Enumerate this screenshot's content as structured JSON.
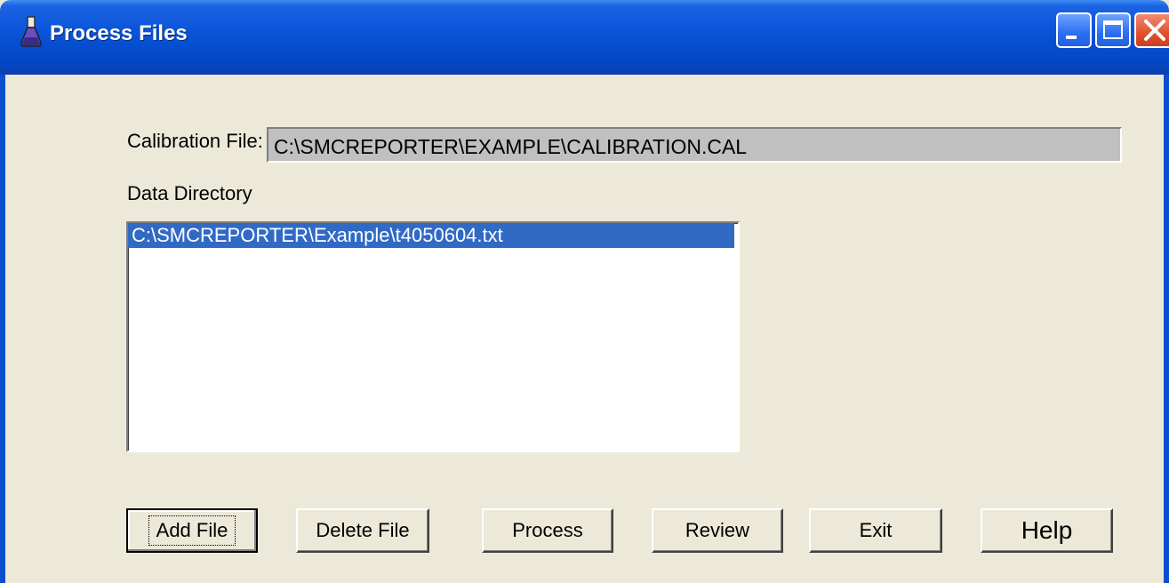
{
  "window": {
    "title": "Process Files"
  },
  "fields": {
    "calibration_label": "Calibration File:",
    "calibration_value": "C:\\SMCREPORTER\\EXAMPLE\\CALIBRATION.CAL",
    "data_directory_label": "Data Directory"
  },
  "data_files": [
    {
      "path": "C:\\SMCREPORTER\\Example\\t4050604.txt",
      "selected": true
    }
  ],
  "buttons": {
    "add_file": "Add File",
    "delete_file": "Delete File",
    "process": "Process",
    "review": "Review",
    "exit": "Exit",
    "help": "Help"
  },
  "colors": {
    "titlebar": "#0a55d9",
    "dialog_background": "#ece9d8",
    "selection": "#316ac5",
    "close_button": "#e0502b"
  },
  "icons": [
    "flask-icon",
    "minimize-icon",
    "maximize-icon",
    "close-icon"
  ]
}
